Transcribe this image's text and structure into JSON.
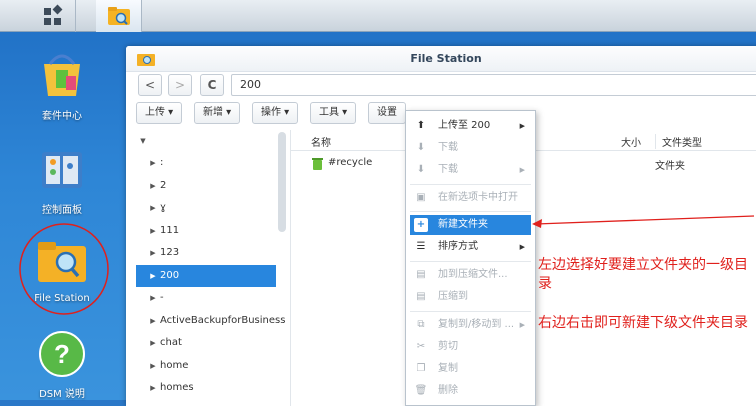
{
  "desktop": {
    "icons": [
      {
        "label": "套件中心"
      },
      {
        "label": "控制面板"
      },
      {
        "label": "File Station"
      },
      {
        "label": "DSM 说明"
      }
    ]
  },
  "window": {
    "title": "File Station",
    "path": "200",
    "refresh_glyph": "C",
    "back_glyph": "<",
    "forward_glyph": ">",
    "star_glyph": "★",
    "toolbar": {
      "upload": "上传",
      "create": "新增",
      "action": "操作",
      "tools": "工具",
      "settings": "设置"
    },
    "tree": {
      "items": [
        {
          "label": "",
          "arrow": "▼"
        },
        {
          "label": ":",
          "arrow": "▶"
        },
        {
          "label": "2",
          "arrow": "▶"
        },
        {
          "label": "ɣ",
          "arrow": "▶"
        },
        {
          "label": "111",
          "arrow": "▶"
        },
        {
          "label": "123",
          "arrow": "▶"
        },
        {
          "label": "200",
          "arrow": "▶"
        },
        {
          "label": "-",
          "arrow": "▶"
        },
        {
          "label": "ActiveBackupforBusiness",
          "arrow": "▶"
        },
        {
          "label": "chat",
          "arrow": "▶"
        },
        {
          "label": "home",
          "arrow": "▶"
        },
        {
          "label": "homes",
          "arrow": "▶"
        }
      ]
    },
    "list": {
      "columns": {
        "name": "名称",
        "size": "大小",
        "type": "文件类型"
      },
      "rows": [
        {
          "name": "#recycle",
          "type": "文件夹"
        }
      ]
    }
  },
  "context_menu": {
    "items": [
      {
        "label": "上传至 200",
        "icon": "upload-icon"
      },
      {
        "label": "下载",
        "icon": "download-icon"
      },
      {
        "label": "下载",
        "icon": "download-icon"
      },
      {
        "label": "在新选项卡中打开",
        "icon": "new-tab-icon"
      },
      {
        "label": "新建文件夹",
        "icon": "new-folder-icon"
      },
      {
        "label": "排序方式",
        "icon": "sort-icon"
      },
      {
        "label": "加到压缩文件...",
        "icon": "archive-icon"
      },
      {
        "label": "压缩到",
        "icon": "compress-icon"
      },
      {
        "label": "复制到/移动到 ...",
        "icon": "copy-move-icon"
      },
      {
        "label": "剪切",
        "icon": "cut-icon"
      },
      {
        "label": "复制",
        "icon": "copy-icon"
      },
      {
        "label": "删除",
        "icon": "delete-icon"
      }
    ]
  },
  "annotations": {
    "left_note": "左边选择好要建立文件夹的一级目录",
    "right_note": "右边右击即可新建下级文件夹目录"
  },
  "colors": {
    "accent": "#2886de",
    "annotation_red": "#e0201c"
  }
}
